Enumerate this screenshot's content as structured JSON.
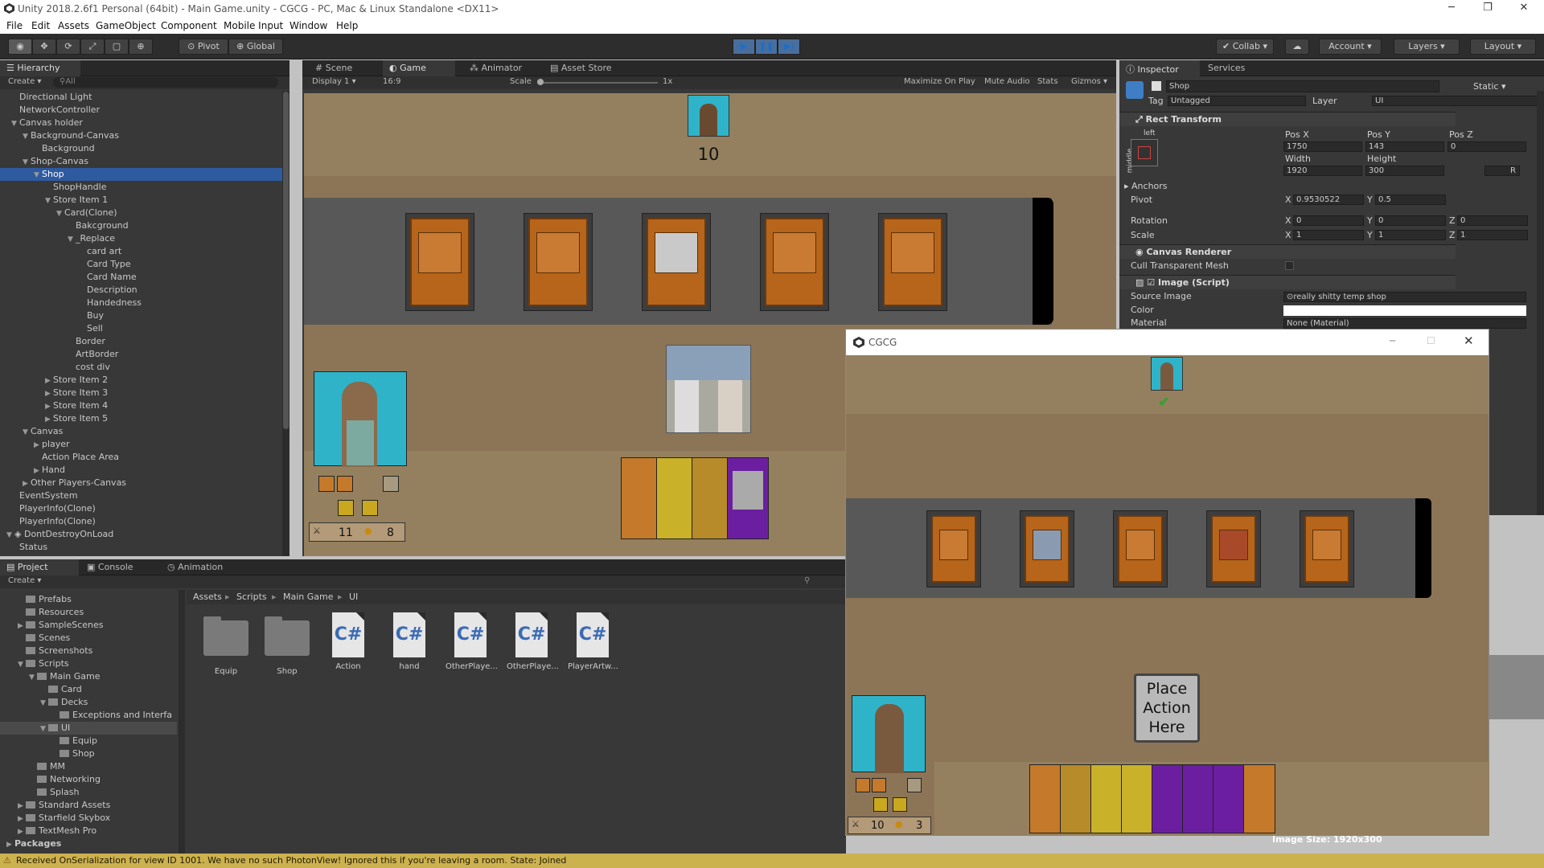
{
  "window": {
    "title": "Unity 2018.2.6f1 Personal (64bit) - Main Game.unity - CGCG - PC, Mac & Linux Standalone <DX11>"
  },
  "menu": [
    "File",
    "Edit",
    "Assets",
    "GameObject",
    "Component",
    "Mobile Input",
    "Window",
    "Help"
  ],
  "toolbar": {
    "pivot": "Pivot",
    "global": "Global",
    "collab": "Collab",
    "account": "Account",
    "layers": "Layers",
    "layout": "Layout"
  },
  "hierarchy": {
    "tab": "Hierarchy",
    "create": "Create",
    "search": "All",
    "items": [
      {
        "label": "Directional Light",
        "indent": 0
      },
      {
        "label": "NetworkController",
        "indent": 0
      },
      {
        "label": "Canvas holder",
        "indent": 0,
        "arrow": "down"
      },
      {
        "label": "Background-Canvas",
        "indent": 1,
        "arrow": "down"
      },
      {
        "label": "Background",
        "indent": 2
      },
      {
        "label": "Shop-Canvas",
        "indent": 1,
        "arrow": "down"
      },
      {
        "label": "Shop",
        "indent": 2,
        "arrow": "down",
        "selected": true
      },
      {
        "label": "ShopHandle",
        "indent": 3
      },
      {
        "label": "Store Item 1",
        "indent": 3,
        "arrow": "down"
      },
      {
        "label": "Card(Clone)",
        "indent": 4,
        "arrow": "down"
      },
      {
        "label": "Bakcground",
        "indent": 5
      },
      {
        "label": "_Replace",
        "indent": 5,
        "arrow": "down"
      },
      {
        "label": "card art",
        "indent": 6
      },
      {
        "label": "Card Type",
        "indent": 6
      },
      {
        "label": "Card Name",
        "indent": 6
      },
      {
        "label": "Description",
        "indent": 6
      },
      {
        "label": "Handedness",
        "indent": 6
      },
      {
        "label": "Buy",
        "indent": 6
      },
      {
        "label": "Sell",
        "indent": 6
      },
      {
        "label": "Border",
        "indent": 5
      },
      {
        "label": "ArtBorder",
        "indent": 5
      },
      {
        "label": "cost div",
        "indent": 5
      },
      {
        "label": "Store Item 2",
        "indent": 3,
        "arrow": "right"
      },
      {
        "label": "Store Item 3",
        "indent": 3,
        "arrow": "right"
      },
      {
        "label": "Store Item 4",
        "indent": 3,
        "arrow": "right"
      },
      {
        "label": "Store Item 5",
        "indent": 3,
        "arrow": "right"
      },
      {
        "label": "Canvas",
        "indent": 1,
        "arrow": "down"
      },
      {
        "label": "player",
        "indent": 2,
        "arrow": "right"
      },
      {
        "label": "Action Place Area",
        "indent": 2
      },
      {
        "label": "Hand",
        "indent": 2,
        "arrow": "right"
      },
      {
        "label": "Other Players-Canvas",
        "indent": 1,
        "arrow": "right"
      },
      {
        "label": "EventSystem",
        "indent": 0
      },
      {
        "label": "PlayerInfo(Clone)",
        "indent": 0
      },
      {
        "label": "PlayerInfo(Clone)",
        "indent": 0
      },
      {
        "label": "DontDestroyOnLoad",
        "indent": -1,
        "arrow": "down",
        "scene": true
      },
      {
        "label": "Status",
        "indent": 0
      }
    ]
  },
  "viewTabs": {
    "scene": "Scene",
    "game": "Game",
    "animator": "Animator",
    "asset_store": "Asset Store"
  },
  "gameBar": {
    "display": "Display 1",
    "aspect": "16:9",
    "scale": "Scale",
    "scale_val": "1x",
    "maximize": "Maximize On Play",
    "mute": "Mute Audio",
    "stats": "Stats",
    "gizmos": "Gizmos"
  },
  "game": {
    "player_count": "10",
    "stat1": "11",
    "stat2": "8"
  },
  "inspector": {
    "tab": "Inspector",
    "services": "Services",
    "name": "Shop",
    "static": "Static",
    "tag_label": "Tag",
    "tag": "Untagged",
    "layer_label": "Layer",
    "layer": "UI",
    "rect_transform": "Rect Transform",
    "left": "left",
    "middle": "middle",
    "posx_label": "Pos X",
    "posy_label": "Pos Y",
    "posz_label": "Pos Z",
    "posx": "1750",
    "posy": "143",
    "posz": "0",
    "width_label": "Width",
    "height_label": "Height",
    "width": "1920",
    "height": "300",
    "anchors": "Anchors",
    "pivot_label": "Pivot",
    "pivot_x": "0.9530522",
    "pivot_y": "0.5",
    "rotation_label": "Rotation",
    "rot_x": "0",
    "rot_y": "0",
    "rot_z": "0",
    "scale_label": "Scale",
    "scale_x": "1",
    "scale_y": "1",
    "scale_z": "1",
    "x": "X",
    "y": "Y",
    "z": "Z",
    "r": "R",
    "canvas_renderer": "Canvas Renderer",
    "cull": "Cull Transparent Mesh",
    "image_script": "Image (Script)",
    "source_image_label": "Source Image",
    "source_image": "really shitty temp shop",
    "color_label": "Color",
    "material_label": "Material",
    "material": "None (Material)"
  },
  "popup": {
    "title": "CGCG",
    "place_action": "Place Action Here",
    "stat1": "10",
    "stat2": "3"
  },
  "image_size": "Image Size: 1920x300",
  "bottomTabs": {
    "project": "Project",
    "console": "Console",
    "animation": "Animation",
    "create": "Create"
  },
  "breadcrumb": [
    "Assets",
    "Scripts",
    "Main Game",
    "UI"
  ],
  "projectTree": [
    {
      "label": "Prefabs",
      "indent": 1
    },
    {
      "label": "Resources",
      "indent": 1
    },
    {
      "label": "SampleScenes",
      "indent": 1,
      "arrow": "right"
    },
    {
      "label": "Scenes",
      "indent": 1
    },
    {
      "label": "Screenshots",
      "indent": 1
    },
    {
      "label": "Scripts",
      "indent": 1,
      "arrow": "down"
    },
    {
      "label": "Main Game",
      "indent": 2,
      "arrow": "down"
    },
    {
      "label": "Card",
      "indent": 3
    },
    {
      "label": "Decks",
      "indent": 3,
      "arrow": "down"
    },
    {
      "label": "Exceptions and Interfa",
      "indent": 4
    },
    {
      "label": "UI",
      "indent": 3,
      "arrow": "down",
      "selected": true
    },
    {
      "label": "Equip",
      "indent": 4
    },
    {
      "label": "Shop",
      "indent": 4
    },
    {
      "label": "MM",
      "indent": 2
    },
    {
      "label": "Networking",
      "indent": 2
    },
    {
      "label": "Splash",
      "indent": 2
    },
    {
      "label": "Standard Assets",
      "indent": 1,
      "arrow": "right"
    },
    {
      "label": "Starfield Skybox",
      "indent": 1,
      "arrow": "right"
    },
    {
      "label": "TextMesh Pro",
      "indent": 1,
      "arrow": "right"
    },
    {
      "label": "Packages",
      "indent": 0,
      "arrow": "right",
      "bold": true
    }
  ],
  "assets": [
    {
      "label": "Equip",
      "type": "folder"
    },
    {
      "label": "Shop",
      "type": "folder"
    },
    {
      "label": "Action",
      "type": "cs"
    },
    {
      "label": "hand",
      "type": "cs"
    },
    {
      "label": "OtherPlaye...",
      "type": "cs"
    },
    {
      "label": "OtherPlaye...",
      "type": "cs"
    },
    {
      "label": "PlayerArtw...",
      "type": "cs"
    }
  ],
  "cs_glyph": "C#",
  "status": "Received OnSerialization for view ID 1001. We have no such PhotonView! Ignored this if you're leaving a room. State: Joined"
}
